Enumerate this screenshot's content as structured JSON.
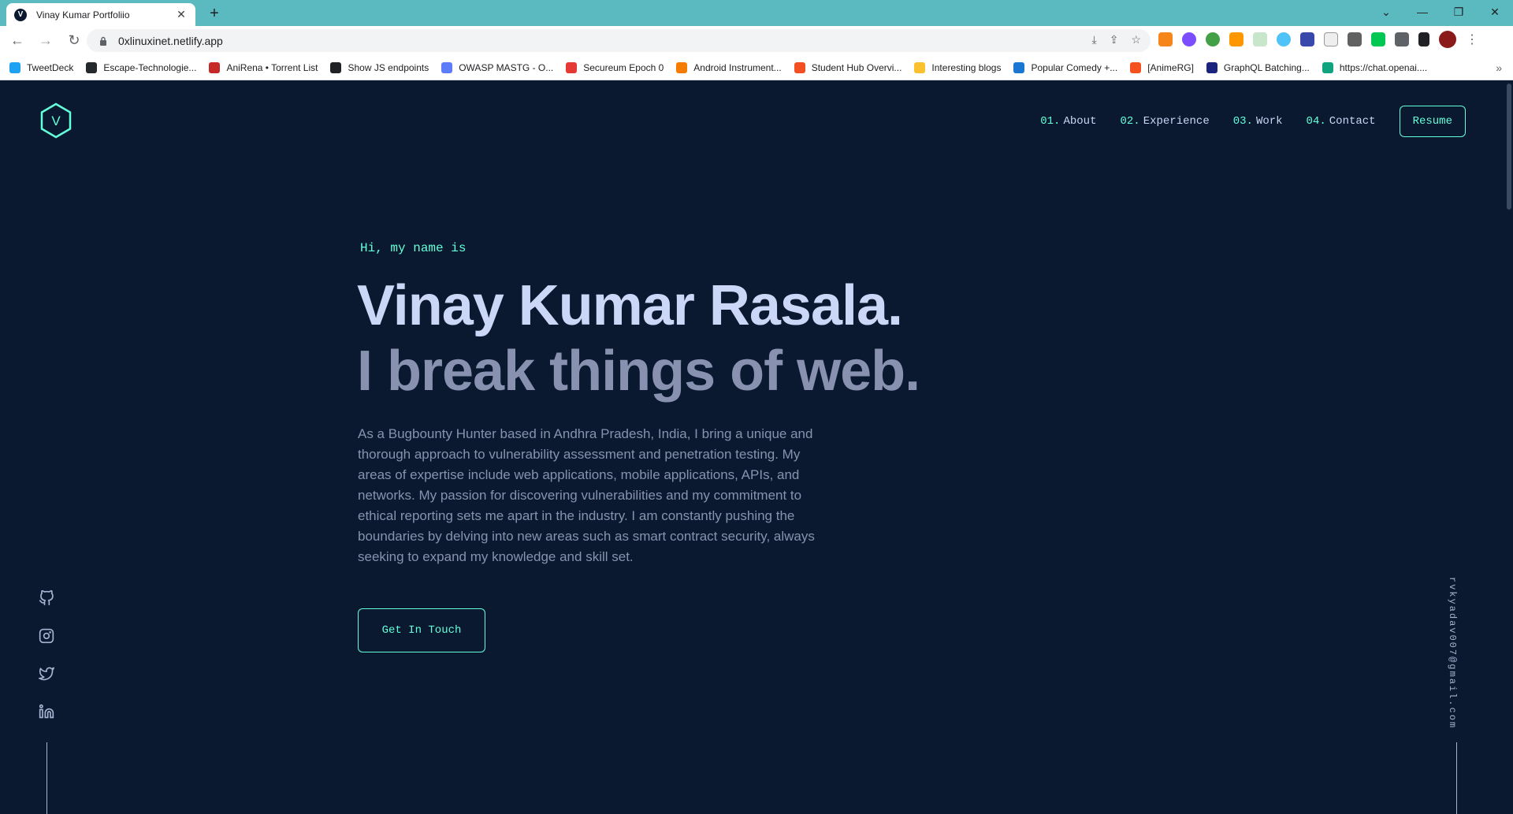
{
  "browser": {
    "tab_title": "Vinay Kumar Portfoliio",
    "favicon_letter": "V",
    "url": "0xlinuxinet.netlify.app",
    "bookmarks": [
      {
        "label": "TweetDeck",
        "color": "#1da1f2"
      },
      {
        "label": "Escape-Technologie...",
        "color": "#24292e"
      },
      {
        "label": "AniRena • Torrent List",
        "color": "#c62828"
      },
      {
        "label": "Show JS endpoints",
        "color": "#202124"
      },
      {
        "label": "OWASP MASTG - O...",
        "color": "#5c7cfa"
      },
      {
        "label": "Secureum Epoch 0",
        "color": "#e53935"
      },
      {
        "label": "Android Instrument...",
        "color": "#f57c00"
      },
      {
        "label": "Student Hub Overvi...",
        "color": "#f25022"
      },
      {
        "label": "Interesting blogs",
        "color": "#fbc02d"
      },
      {
        "label": "Popular Comedy +...",
        "color": "#1976d2"
      },
      {
        "label": "[AnimeRG]",
        "color": "#f4511e"
      },
      {
        "label": "GraphQL Batching...",
        "color": "#1a237e"
      },
      {
        "label": "https://chat.openai....",
        "color": "#10a37f"
      }
    ],
    "more_bookmarks": "»"
  },
  "header": {
    "logo_letter": "V",
    "nav": [
      {
        "num": "01.",
        "label": "About"
      },
      {
        "num": "02.",
        "label": "Experience"
      },
      {
        "num": "03.",
        "label": "Work"
      },
      {
        "num": "04.",
        "label": "Contact"
      }
    ],
    "resume_label": "Resume"
  },
  "hero": {
    "greeting": "Hi, my name is",
    "name": "Vinay Kumar Rasala.",
    "tagline": "I break things of web.",
    "bio": "As a Bugbounty Hunter based in Andhra Pradesh, India, I bring a unique and thorough approach to vulnerability assessment and penetration testing. My areas of expertise include web applications, mobile applications, APIs, and networks. My passion for discovering vulnerabilities and my commitment to ethical reporting sets me apart in the industry. I am constantly pushing the boundaries by delving into new areas such as smart contract security, always seeking to expand my knowledge and skill set.",
    "cta_label": "Get In Touch"
  },
  "side": {
    "socials": [
      "github-icon",
      "instagram-icon",
      "twitter-icon",
      "linkedin-icon"
    ],
    "email": "rvkyadav007@gmail.com"
  },
  "colors": {
    "background": "#0a192f",
    "accent": "#64ffda",
    "heading": "#ccd6f6",
    "text": "#8892b0",
    "chrome_teal": "#5bb9c0"
  }
}
